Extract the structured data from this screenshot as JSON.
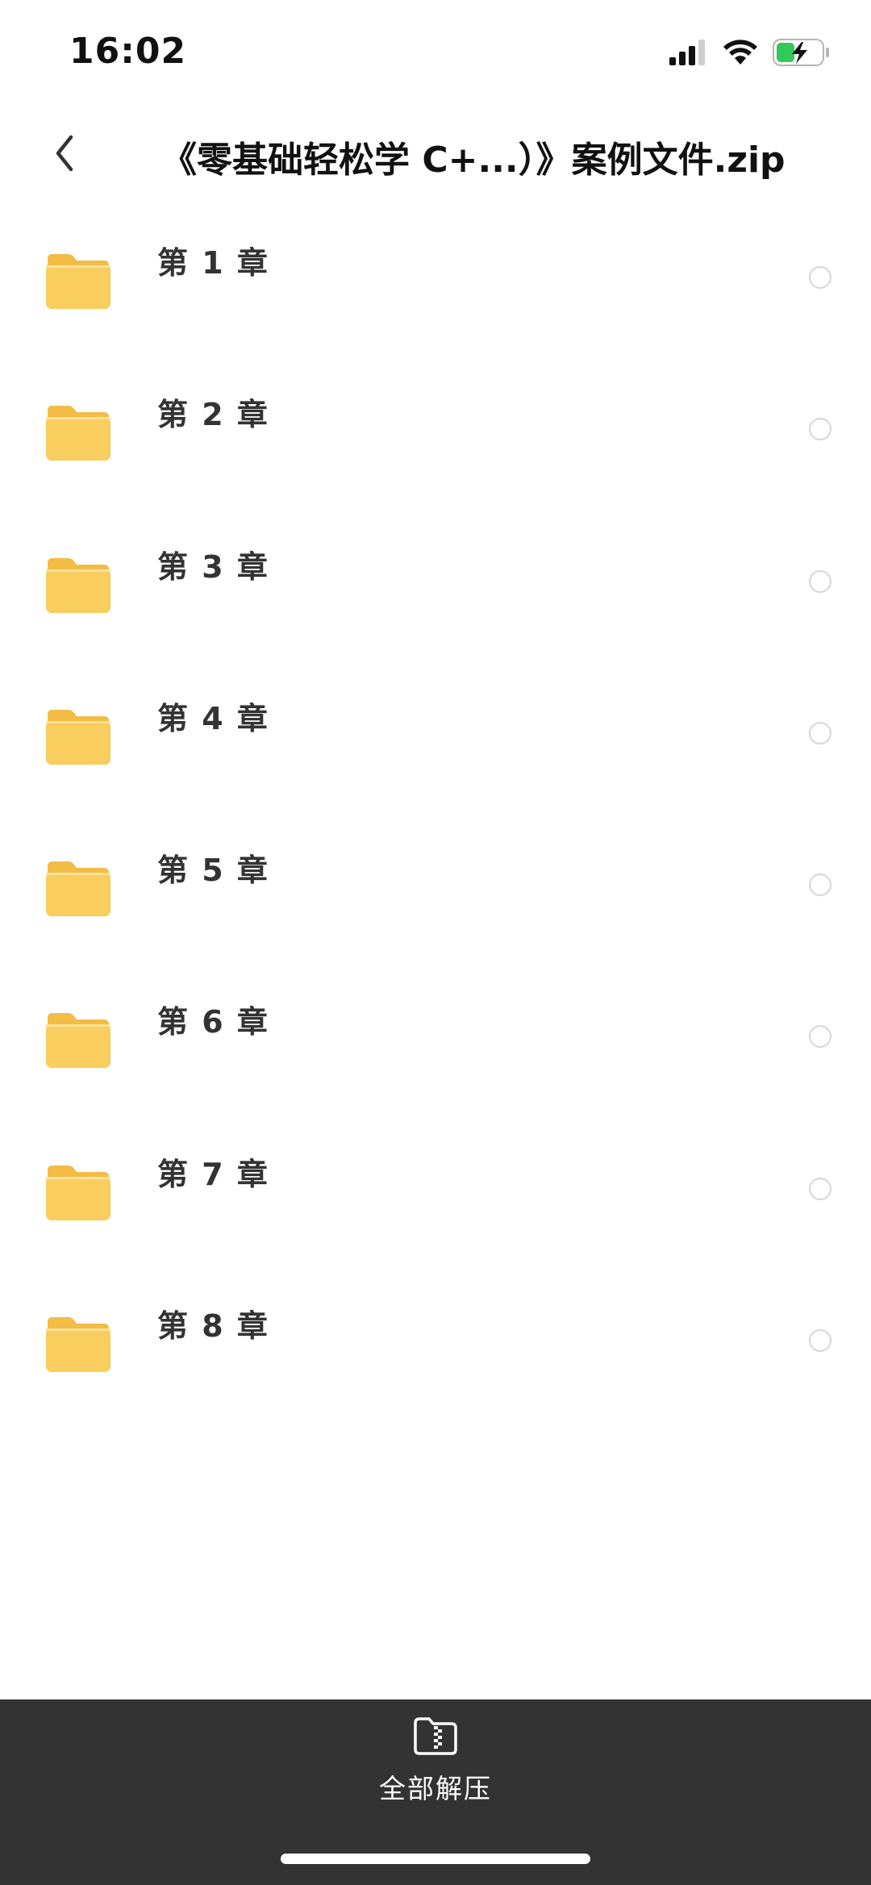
{
  "status_bar": {
    "time": "16:02",
    "icons": [
      "cellular-signal-icon",
      "wifi-icon",
      "battery-charging-icon"
    ]
  },
  "nav": {
    "back_icon": "chevron-left-icon",
    "title": "《零基础轻松学 C+...）》案例文件.zip"
  },
  "files": [
    {
      "name": "第 1 章",
      "icon": "folder-icon",
      "selected": false
    },
    {
      "name": "第 2 章",
      "icon": "folder-icon",
      "selected": false
    },
    {
      "name": "第 3 章",
      "icon": "folder-icon",
      "selected": false
    },
    {
      "name": "第 4 章",
      "icon": "folder-icon",
      "selected": false
    },
    {
      "name": "第 5 章",
      "icon": "folder-icon",
      "selected": false
    },
    {
      "name": "第 6 章",
      "icon": "folder-icon",
      "selected": false
    },
    {
      "name": "第 7 章",
      "icon": "folder-icon",
      "selected": false
    },
    {
      "name": "第 8 章",
      "icon": "folder-icon",
      "selected": false
    }
  ],
  "bottom_bar": {
    "extract_icon": "zip-folder-icon",
    "extract_label": "全部解压"
  },
  "colors": {
    "folder": "#F9CD5E",
    "folder_tab": "#F3BC45",
    "bottom_bar": "#333333",
    "battery_green": "#34C759"
  }
}
